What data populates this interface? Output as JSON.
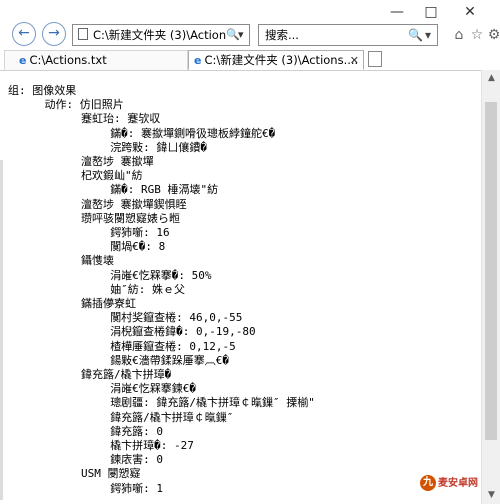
{
  "window": {
    "minimize": "—",
    "maximize": "□",
    "close": "✕"
  },
  "nav": {
    "back_icon": "←",
    "forward_icon": "→"
  },
  "address": {
    "value": "C:\\新建文件夹 (3)\\Action",
    "dropdown": "▾",
    "search_sep": "🔍",
    "refresh": "✕"
  },
  "search": {
    "placeholder": "搜索...",
    "go": "🔍",
    "dropdown": "▾"
  },
  "right_icons": {
    "home": "⌂",
    "favorites": "☆",
    "settings": "⚙",
    "smiley": "☺"
  },
  "tabs": [
    {
      "label": "C:\\Actions.txt",
      "active": false
    },
    {
      "label": "C:\\新建文件夹 (3)\\Actions....",
      "active": true
    }
  ],
  "content": {
    "lines": [
      {
        "indent": 0,
        "text": "组: 图像效果"
      },
      {
        "indent": 5,
        "text": "动作: 仿旧照片"
      },
      {
        "indent": 10,
        "text": "蹇虹珆: 蹇欤収"
      },
      {
        "indent": 14,
        "text": "鏋�: 褰撳墠鍘嗗彶璁板綍鐘舵€�"
      },
      {
        "indent": 14,
        "text": "浣跨敤: 鍏ㄩ儴鐨�"
      },
      {
        "indent": 10,
        "text": "澶嶅埗 褰撳墠"
      },
      {
        "indent": 10,
        "text": "杞欢鍜屾\"紡"
      },
      {
        "indent": 14,
        "text": "鏋�: RGB 棰滆壊\"紡"
      },
      {
        "indent": 10,
        "text": "澶嶅埗 褰撳墠鍥惧眰"
      },
      {
        "indent": 10,
        "text": "瓒呯骇閿愬寲婊ら暅"
      },
      {
        "indent": 14,
        "text": "鍔犻噺: 16"
      },
      {
        "indent": 14,
        "text": "闃堝€�: 8"
      },
      {
        "indent": 10,
        "text": "鑷愯壊"
      },
      {
        "indent": 14,
        "text": "涓嶉€忔槑搴�: 50%"
      },
      {
        "indent": 14,
        "text": "妯″紡: 姝ｅ父"
      },
      {
        "indent": 10,
        "text": "鏋插儚寮虹"
      },
      {
        "indent": 14,
        "text": "闃村奖鑹查棬: 46,0,-55"
      },
      {
        "indent": 14,
        "text": "涓棿鑹查棬鍏�: 0,-19,-80"
      },
      {
        "indent": 14,
        "text": "楂樺厜鑹查棬: 0,12,-5"
      },
      {
        "indent": 14,
        "text": "鍚敤€濇帶鍒跺厜搴︹€�"
      },
      {
        "indent": 10,
        "text": "鍏充簬/橇卞拼璋�"
      },
      {
        "indent": 14,
        "text": "涓嶉€忔槑搴鍊€�"
      },
      {
        "indent": 14,
        "text": "璁剧疆: 鍏充簬/橇卞拼璋￠暣鏁″ 搮椾\""
      },
      {
        "indent": 14,
        "text": "鍏充簬/橇卞拼璋￠暣鏁″"
      },
      {
        "indent": 14,
        "text": "鍏充簬: 0"
      },
      {
        "indent": 14,
        "text": "橇卞拼璋�: -27"
      },
      {
        "indent": 14,
        "text": "鍊庡害: 0"
      },
      {
        "indent": 10,
        "text": "USM 閿愬寲"
      },
      {
        "indent": 14,
        "text": "鍔犻噺: 1"
      }
    ]
  },
  "watermark": {
    "logo": "九",
    "text": "麦安卓网"
  }
}
